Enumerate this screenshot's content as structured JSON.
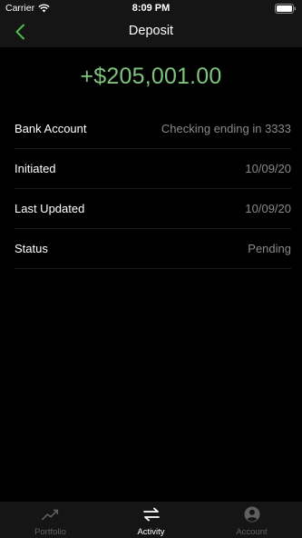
{
  "status_bar": {
    "carrier": "Carrier",
    "time": "8:09 PM",
    "icons": [
      "wifi-icon",
      "battery-icon"
    ]
  },
  "nav": {
    "title": "Deposit",
    "back_icon": "chevron-left-icon"
  },
  "deposit": {
    "amount": "+$205,001.00"
  },
  "details": [
    {
      "label": "Bank Account",
      "value": "Checking ending in 3333"
    },
    {
      "label": "Initiated",
      "value": "10/09/20"
    },
    {
      "label": "Last Updated",
      "value": "10/09/20"
    },
    {
      "label": "Status",
      "value": "Pending"
    }
  ],
  "tab_bar": {
    "tabs": [
      {
        "label": "Portfolio",
        "icon": "chart-line-icon",
        "active": false
      },
      {
        "label": "Activity",
        "icon": "swap-arrows-icon",
        "active": true
      },
      {
        "label": "Account",
        "icon": "user-circle-icon",
        "active": false
      }
    ]
  },
  "colors": {
    "background": "#000000",
    "bars": "#151515",
    "amount_green": "#7ec47e",
    "accent_green": "#4cbe4c",
    "secondary_text": "#8a8a8a",
    "inactive_tab": "#5f5f5f"
  }
}
